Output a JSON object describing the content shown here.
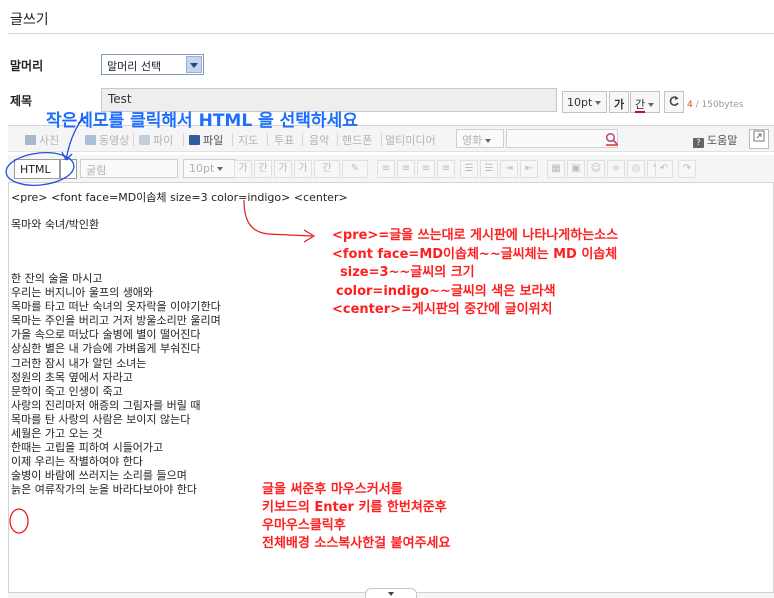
{
  "page": {
    "title": "글쓰기"
  },
  "header": {
    "label": "말머리",
    "select_value": "말머리 선택"
  },
  "subject": {
    "label": "제목",
    "value": "Test",
    "font_size": "10pt",
    "bold": "가",
    "color": "간",
    "counter_current": "4",
    "counter_max": "/ 150bytes"
  },
  "toolbar1": {
    "items": [
      "사진",
      "동영상",
      "파이",
      "파일",
      "지도",
      "투표",
      "음악",
      "핸드폰",
      "멀티미디어"
    ],
    "search_select": "영화",
    "help": "도움말"
  },
  "toolbar2": {
    "mode": "HTML",
    "font": "굴림",
    "size": "10pt",
    "format_glyphs": [
      "가",
      "간",
      "가",
      "가",
      "간"
    ]
  },
  "editor": {
    "code_line": "<pre> <font face=MD이솝체 size=3 color=indigo> <center>",
    "poem_title": "목마와 숙녀/박인환",
    "poem_lines": [
      "한 잔의 술을 마시고",
      "우리는 버지니아 울프의 생애와",
      "목마를 타고 떠난 숙녀의 옷자락을 이야기한다",
      "목마는 주인을 버리고 거저 방울소리만 울리며",
      "가을 속으로 떠났다 술병에 별이 떨어진다",
      "상심한 별은 내 가슴에 가벼웁게 부숴진다",
      "그러한 잠시 내가 알던 소녀는",
      "정원의 초목 옆에서 자라고",
      "문학이 죽고 인생이 죽고",
      "사랑의 진리마저 애증의 그림자를 버릴 때",
      "목마를 탄 사랑의 사람은 보이지 않는다",
      "세월은 가고 오는 것",
      "한때는 고립을 피하여 시들어가고",
      "이제 우리는 작별하여야 한다",
      "술병이 바람에 쓰러지는 소리를 들으며",
      "늙은 여류작가의 눈을 바라다보아야 한다"
    ]
  },
  "annotations": {
    "top_blue": "작은세모를 클릭해서 HTML 을 선택하세요",
    "middle_red": [
      "<pre>=글을 쓰는대로 게시판에 나타나게하는소스",
      "<font face=MD이솝체~~글씨체는 MD 이솝체",
      "size=3~~글씨의 크기",
      "color=indigo~~글씨의 색은 보라색",
      "<center>=게시판의 중간에 글이위치"
    ],
    "bottom_red": [
      "글을 써준후 마우스커서를",
      "키보드의 Enter 키를 한번쳐준후",
      "우마우스클릭후",
      "전체배경 소스복사한걸 붙여주세요"
    ]
  },
  "colors": {
    "annotation_blue": "#1e6fff",
    "annotation_red": "#ff1f1f",
    "counter_red": "#e84b19",
    "toolbar_bg": "#f5f5f5"
  }
}
